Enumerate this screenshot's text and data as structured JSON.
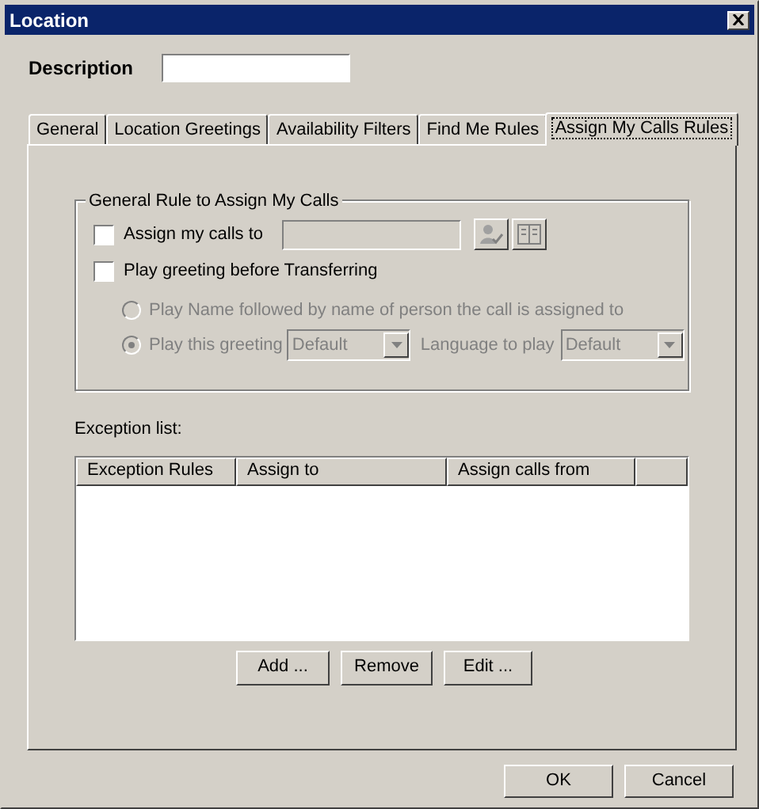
{
  "window": {
    "title": "Location"
  },
  "description": {
    "label": "Description"
  },
  "tabs": [
    {
      "label": "General",
      "selected": false
    },
    {
      "label": "Location Greetings",
      "selected": false
    },
    {
      "label": "Availability Filters",
      "selected": false
    },
    {
      "label": "Find Me Rules",
      "selected": false
    },
    {
      "label": "Assign My Calls Rules",
      "selected": true
    }
  ],
  "group": {
    "title": "General Rule to Assign My Calls",
    "assign_calls": {
      "label": "Assign my calls to",
      "checked": false,
      "field_disabled": true
    },
    "play_greeting": {
      "label": "Play greeting before Transferring",
      "checked": false
    },
    "options": [
      {
        "label": "Play Name followed by name of person the call is assigned to",
        "selected": false,
        "disabled": true
      },
      {
        "label": "Play this greeting",
        "selected": true,
        "disabled": true
      }
    ],
    "greeting_select": {
      "value": "Default",
      "disabled": true
    },
    "language": {
      "label": "Language to play",
      "value": "Default",
      "disabled": true
    }
  },
  "exception_list": {
    "label": "Exception list:",
    "columns": [
      "Exception Rules",
      "Assign to",
      "Assign calls from"
    ]
  },
  "list_buttons": [
    "Add ...",
    "Remove",
    "Edit ..."
  ],
  "dialog_buttons": [
    "OK",
    "Cancel"
  ]
}
